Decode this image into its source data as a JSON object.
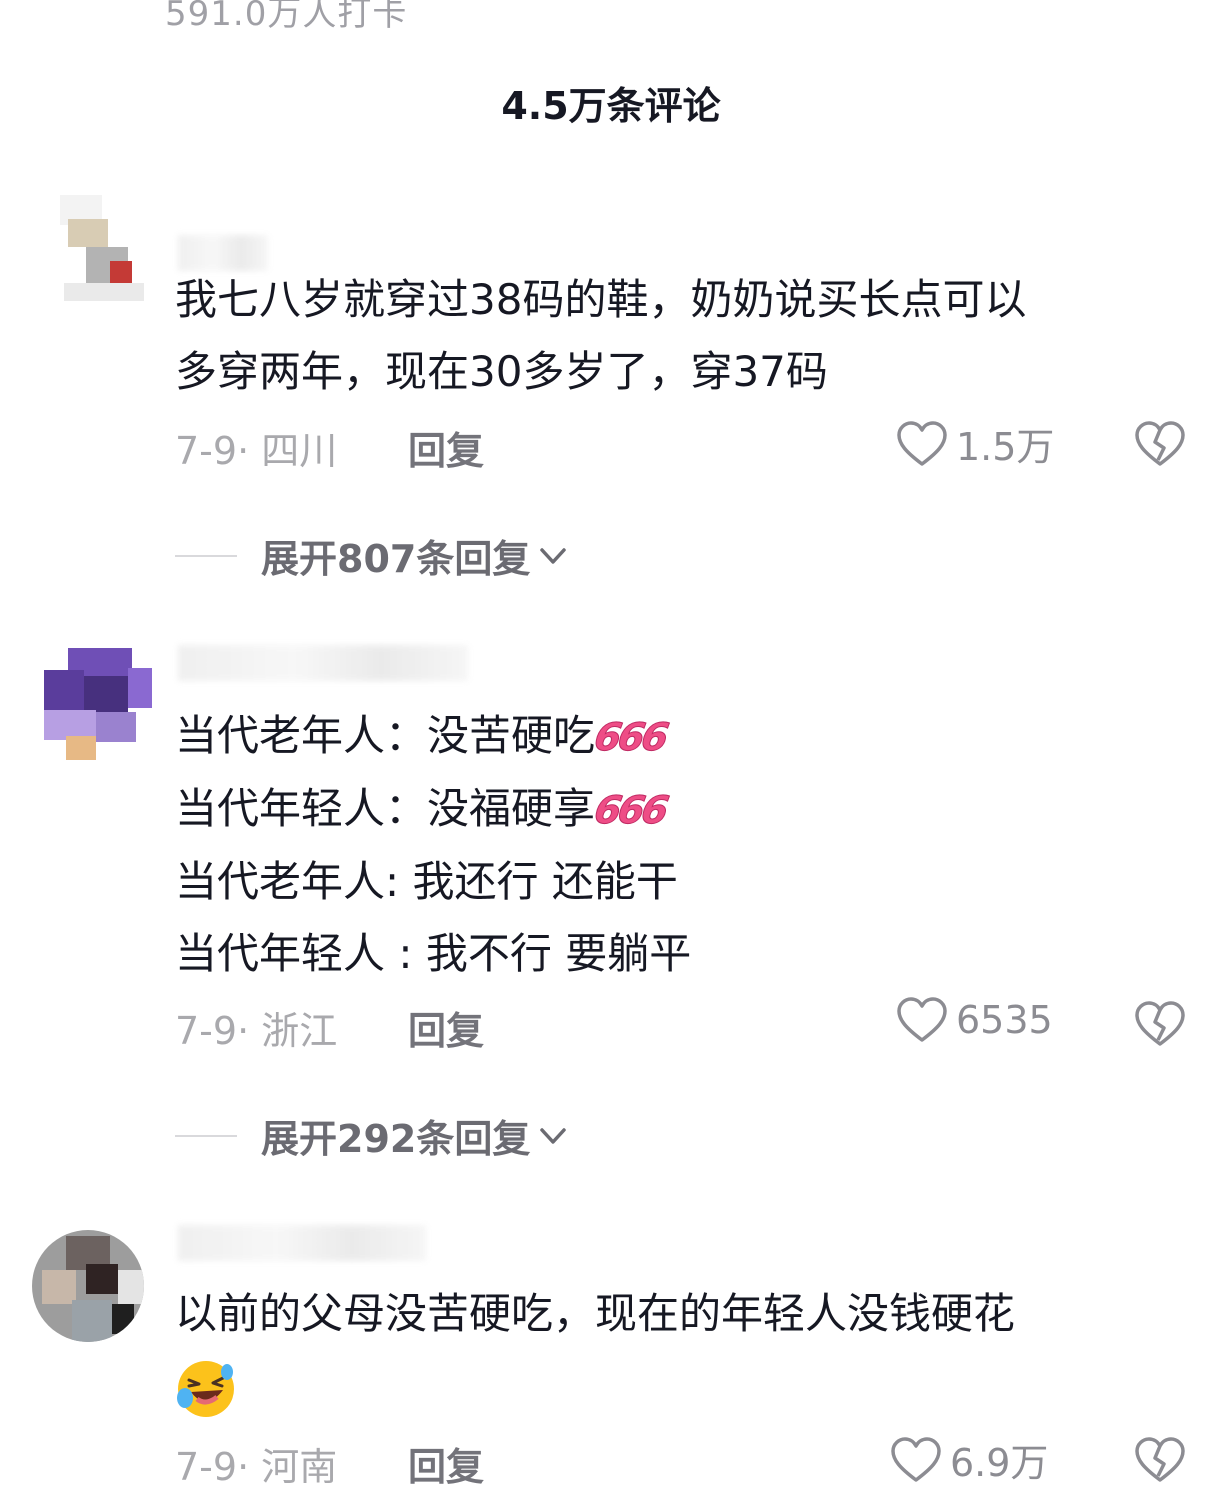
{
  "header": {
    "checkin_text": "591.0万人打卡",
    "comments_title": "4.5万条评论"
  },
  "comments": [
    {
      "lines": [
        "我七八岁就穿过38码的鞋，奶奶说买长点可以",
        "多穿两年，现在30多岁了，穿37码"
      ],
      "meta": "7-9· 四川",
      "reply_label": "回复",
      "likes": "1.5万",
      "expand_label": "展开807条回复"
    },
    {
      "lines": [
        "当代老年人：没苦硬吃",
        "当代年轻人：没福硬享",
        "当代老年人: 我还行  还能干",
        "当代年轻人 : 我不行  要躺平"
      ],
      "emoji_text": "666",
      "meta": "7-9· 浙江",
      "reply_label": "回复",
      "likes": "6535",
      "expand_label": "展开292条回复"
    },
    {
      "lines": [
        "以前的父母没苦硬吃，现在的年轻人没钱硬花"
      ],
      "meta": "7-9· 河南",
      "reply_label": "回复",
      "likes": "6.9万"
    }
  ],
  "colors": {
    "text": "#161823",
    "meta": "#a9a9ad",
    "emoji_pink": "#ee4d86"
  },
  "icons": [
    "heart-icon",
    "broken-heart-icon",
    "chevron-down-icon",
    "laughing-emoji-icon"
  ]
}
